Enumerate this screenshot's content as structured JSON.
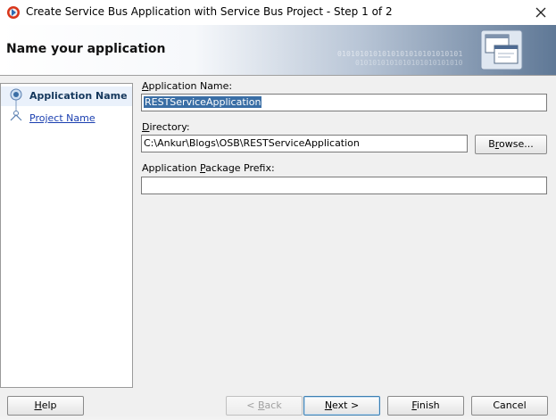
{
  "window": {
    "title": "Create Service Bus Application with Service Bus Project - Step 1 of 2"
  },
  "banner": {
    "title": "Name your application",
    "binary_line1": "0101010101010101010101010101",
    "binary_line2": "0101010101010101010101010"
  },
  "steps": [
    {
      "label": "Application Name",
      "state": "current"
    },
    {
      "label": "Project Name",
      "state": "link"
    }
  ],
  "form": {
    "app_name_label_pre": "",
    "app_name_label_mnemonic": "A",
    "app_name_label_post": "pplication Name:",
    "app_name_value": "RESTServiceApplication",
    "directory_label_pre": "",
    "directory_label_mnemonic": "D",
    "directory_label_post": "irectory:",
    "directory_value": "C:\\Ankur\\Blogs\\OSB\\RESTServiceApplication",
    "browse_label_pre": "B",
    "browse_label_mnemonic": "r",
    "browse_label_post": "owse...",
    "package_label_pre": "Application ",
    "package_label_mnemonic": "P",
    "package_label_post": "ackage Prefix:",
    "package_value": ""
  },
  "buttons": {
    "help_mnemonic": "H",
    "help_rest": "elp",
    "back_pre": "< ",
    "back_mnemonic": "B",
    "back_rest": "ack",
    "next_mnemonic": "N",
    "next_rest": "ext >",
    "finish_mnemonic": "F",
    "finish_rest": "inish",
    "cancel_label": "Cancel"
  },
  "colors": {
    "accent": "#3a6ea5",
    "link": "#1a3fb0",
    "step_active_text": "#14375c"
  }
}
